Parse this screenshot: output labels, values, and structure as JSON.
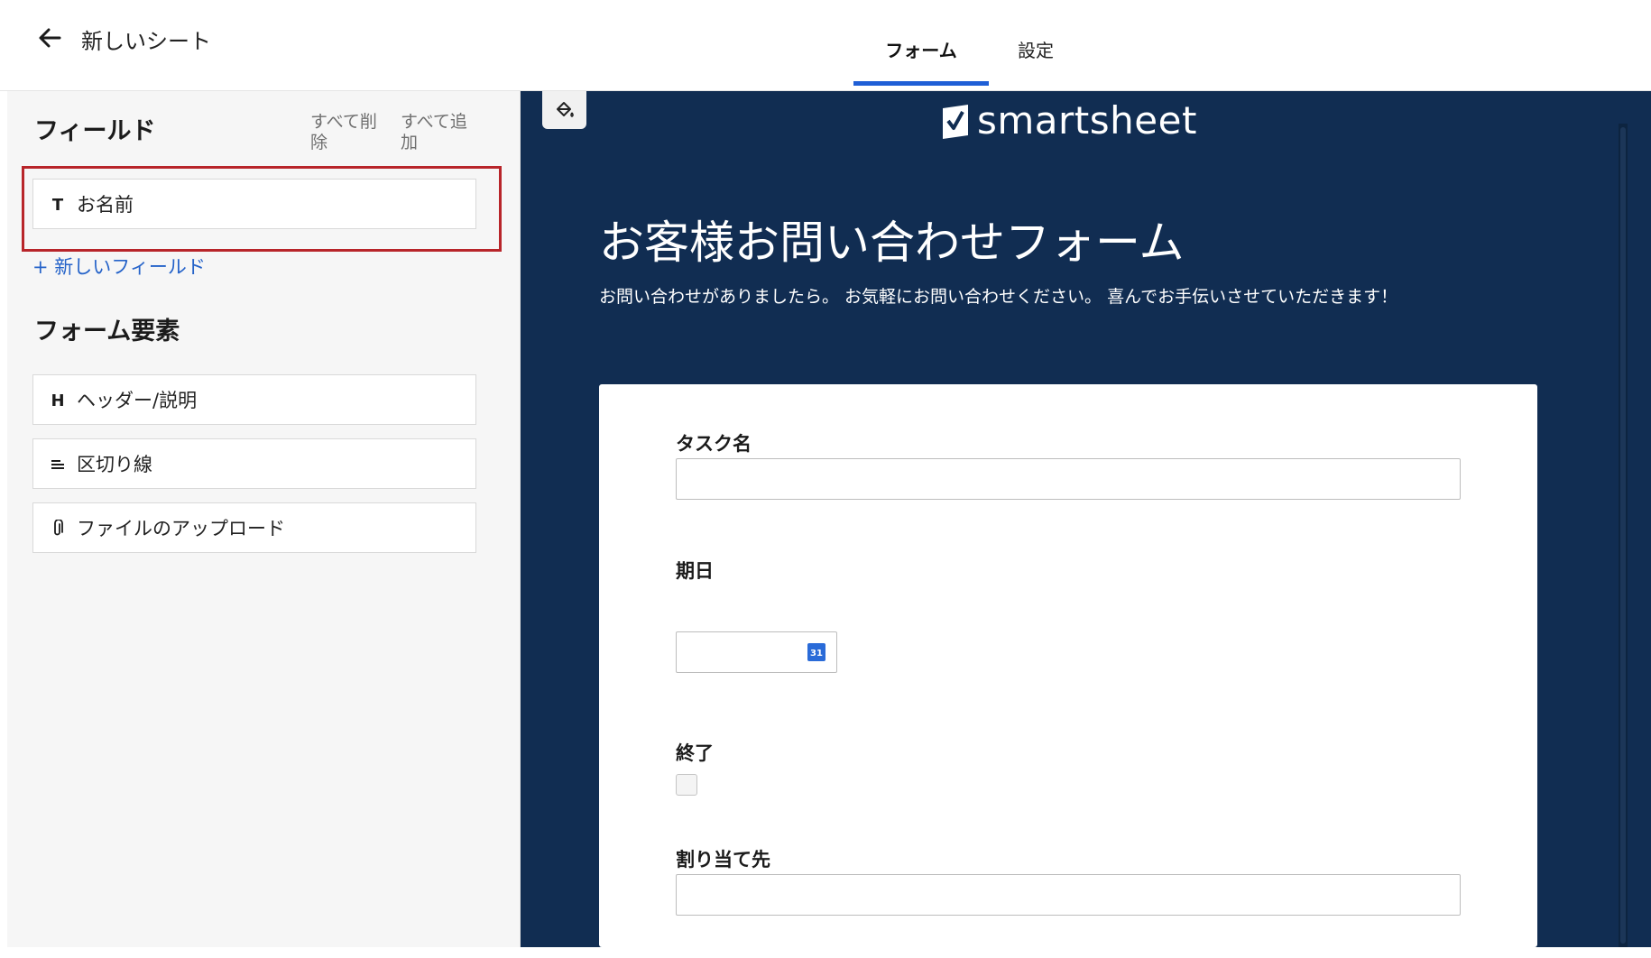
{
  "header": {
    "sheet_title": "新しいシート",
    "tabs": [
      {
        "label": "フォーム",
        "active": true
      },
      {
        "label": "設定",
        "active": false
      }
    ],
    "accent_color": "#1f5fd6"
  },
  "sidebar": {
    "fields_title": "フィールド",
    "remove_all": "すべて削除",
    "add_all": "すべて追加",
    "fields": [
      {
        "icon": "T",
        "label": "お名前"
      }
    ],
    "new_field_link": "+ 新しいフィールド",
    "elements_title": "フォーム要素",
    "elements": [
      {
        "icon": "H",
        "label": "ヘッダー/説明"
      },
      {
        "icon": "divider-icon",
        "label": "区切り線"
      },
      {
        "icon": "paperclip-icon",
        "label": "ファイルのアップロード"
      }
    ],
    "highlight_color": "#b8252a"
  },
  "preview": {
    "background_color": "#112d52",
    "logo_text": "smartsheet",
    "form_title": "お客様お問い合わせフォーム",
    "form_description": "お問い合わせがありましたら。 お気軽にお問い合わせください。 喜んでお手伝いさせていただきます！",
    "questions": [
      {
        "label": "タスク名",
        "type": "text"
      },
      {
        "label": "期日",
        "type": "date",
        "calendar_icon_text": "31"
      },
      {
        "label": "終了",
        "type": "checkbox"
      },
      {
        "label": "割り当て先",
        "type": "text"
      }
    ]
  }
}
